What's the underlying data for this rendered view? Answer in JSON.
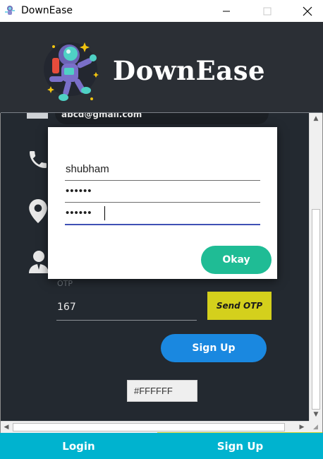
{
  "window": {
    "title": "DownEase",
    "controls": [
      "minimize-icon",
      "maximize-icon",
      "close-icon"
    ]
  },
  "header": {
    "logo_text": "DownEase",
    "logo_icon": "astronaut-icon"
  },
  "form": {
    "email_value": "abcd@gmail.com",
    "email_icon": "mail-icon",
    "phone_icon": "phone-icon",
    "location_icon": "location-pin-icon",
    "user_icon": "user-icon",
    "otp_label": "OTP",
    "otp_value": "167",
    "send_otp_label": "Send OTP",
    "signup_label": "Sign Up",
    "color_value": "#FFFFFF"
  },
  "dialog": {
    "username_value": "shubham",
    "password_value": "••••••",
    "confirm_password_value": "••••••",
    "okay_label": "Okay"
  },
  "bottom_tabs": [
    {
      "label": "Login"
    },
    {
      "label": "Sign Up"
    }
  ],
  "colors": {
    "background": "#2b2f35",
    "content_bg": "#232930",
    "send_otp": "#d4d01c",
    "signup_button": "#1a88e0",
    "okay_button": "#1fbc95",
    "bottom_bar": "#00b3cf",
    "focus_underline": "#3f51b5"
  }
}
